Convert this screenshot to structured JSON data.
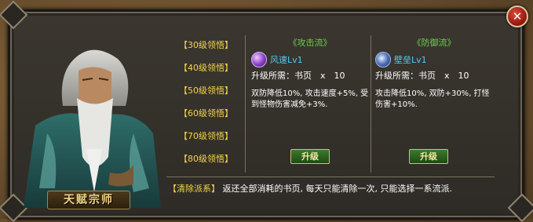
{
  "close_label": "✕",
  "npc": {
    "title": "天赋宗师"
  },
  "tiers": [
    "【30级领悟】",
    "【40级领悟】",
    "【50级领悟】",
    "【60级领悟】",
    "【70级领悟】",
    "【80级领悟】"
  ],
  "schools": [
    {
      "title": "《攻击流》",
      "skill_name": "风速Lv1",
      "requirement": "升级所需：书页　x　10",
      "description": "双防降低10%, 攻击速度+5%, 受到怪物伤害减免+3%.",
      "button": "升级"
    },
    {
      "title": "《防御流》",
      "skill_name": "壁垒Lv1",
      "requirement": "升级所需：书页　x　10",
      "description": "攻击降低10%, 双防+30%, 打怪伤害+10%.",
      "button": "升级"
    }
  ],
  "reset": {
    "tag": "【清除派系】",
    "text": "返还全部消耗的书页, 每天只能清除一次, 只能选择一系流派."
  },
  "colors": {
    "tier_text": "#f4d44a",
    "title_green": "#6cd04a",
    "skill_blue": "#56c8f0"
  }
}
